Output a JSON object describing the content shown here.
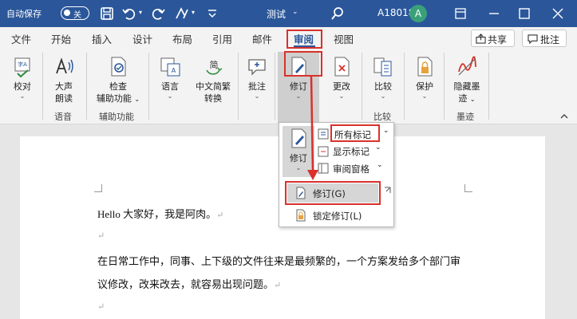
{
  "titlebar": {
    "autosave_label": "自动保存",
    "autosave_state": "关",
    "doc_title": "测试",
    "user_name": "A18018",
    "avatar_initial": "A"
  },
  "tabs": [
    "文件",
    "开始",
    "插入",
    "设计",
    "布局",
    "引用",
    "邮件",
    "审阅",
    "视图"
  ],
  "active_tab": "审阅",
  "actions": {
    "share": "共享",
    "comment": "批注"
  },
  "ribbon": {
    "proofing": "校对",
    "read_aloud": [
      "大声",
      "朗读"
    ],
    "accessibility": [
      "检查",
      "辅助功能"
    ],
    "language": "语言",
    "chinese_conv": [
      "中文简繁",
      "转换"
    ],
    "comment": "批注",
    "track": "修订",
    "changes": "更改",
    "compare": "比较",
    "protect": "保护",
    "ink": [
      "隐藏墨",
      "迹"
    ],
    "groups": {
      "speech": "语音",
      "accessibility": "辅助功能",
      "compare": "比较",
      "ink": "墨迹"
    }
  },
  "dropdown": {
    "track_label": "修订",
    "all_markup": "所有标记",
    "show_markup": "显示标记",
    "review_pane": "审阅窗格",
    "track_changes": "修订(G)",
    "lock_tracking": "锁定修订(L)"
  },
  "document": {
    "lines": [
      "Hello 大家好，我是阿肉。",
      "",
      "在日常工作中，同事、上下级的文件往来是最频繁的，一个方案发给多个部门审",
      "议修改，改来改去，就容易出现问题。",
      ""
    ],
    "paragraph_mark": "↵"
  },
  "colors": {
    "title_bar": "#2b579a",
    "highlight_box": "#d9312b",
    "avatar": "#3aa07a"
  }
}
